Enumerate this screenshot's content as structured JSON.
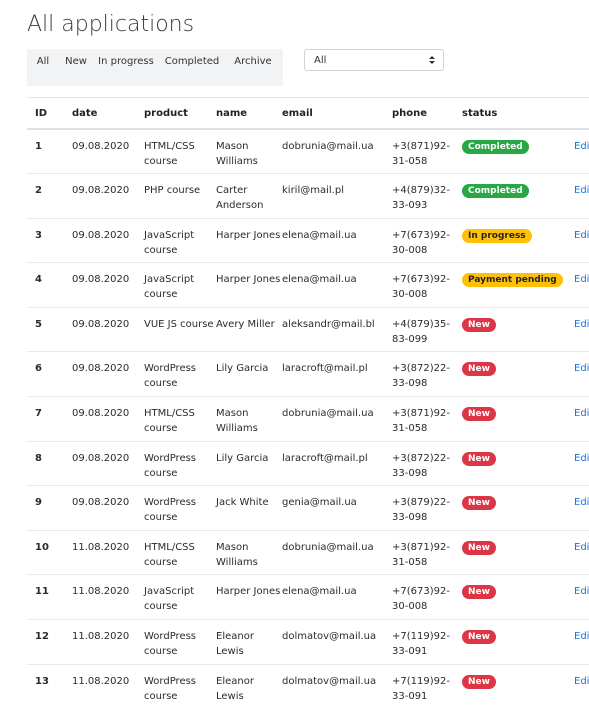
{
  "page_title": "All applications",
  "filters": {
    "tabs": [
      {
        "label": "All"
      },
      {
        "label": "New"
      },
      {
        "label": "In progress"
      },
      {
        "label": "Completed"
      },
      {
        "label": "Archive"
      }
    ],
    "select_value": "All"
  },
  "table": {
    "headers": {
      "id": "ID",
      "date": "date",
      "product": "product",
      "name": "name",
      "email": "email",
      "phone": "phone",
      "status": "status"
    },
    "edit_label": "Edit",
    "rows": [
      {
        "id": "1",
        "date": "09.08.2020",
        "product": "HTML/CSS course",
        "name": "Mason Williams",
        "email": "dobrunia@mail.ua",
        "phone": "+3(871)92-31-058",
        "status": "Completed",
        "status_type": "completed"
      },
      {
        "id": "2",
        "date": "09.08.2020",
        "product": "PHP course",
        "name": "Carter Anderson",
        "email": "kiril@mail.pl",
        "phone": "+4(879)32-33-093",
        "status": "Completed",
        "status_type": "completed"
      },
      {
        "id": "3",
        "date": "09.08.2020",
        "product": "JavaScript course",
        "name": "Harper Jones",
        "email": "elena@mail.ua",
        "phone": "+7(673)92-30-008",
        "status": "In progress",
        "status_type": "progress"
      },
      {
        "id": "4",
        "date": "09.08.2020",
        "product": "JavaScript course",
        "name": "Harper Jones",
        "email": "elena@mail.ua",
        "phone": "+7(673)92-30-008",
        "status": "Payment pending",
        "status_type": "pending"
      },
      {
        "id": "5",
        "date": "09.08.2020",
        "product": "VUE JS course",
        "name": "Avery Miller",
        "email": "aleksandr@mail.bl",
        "phone": "+4(879)35-83-099",
        "status": "New",
        "status_type": "new"
      },
      {
        "id": "6",
        "date": "09.08.2020",
        "product": "WordPress course",
        "name": "Lily Garcia",
        "email": "laracroft@mail.pl",
        "phone": "+3(872)22-33-098",
        "status": "New",
        "status_type": "new"
      },
      {
        "id": "7",
        "date": "09.08.2020",
        "product": "HTML/CSS course",
        "name": "Mason Williams",
        "email": "dobrunia@mail.ua",
        "phone": "+3(871)92-31-058",
        "status": "New",
        "status_type": "new"
      },
      {
        "id": "8",
        "date": "09.08.2020",
        "product": "WordPress course",
        "name": "Lily Garcia",
        "email": "laracroft@mail.pl",
        "phone": "+3(872)22-33-098",
        "status": "New",
        "status_type": "new"
      },
      {
        "id": "9",
        "date": "09.08.2020",
        "product": "WordPress course",
        "name": "Jack White",
        "email": "genia@mail.ua",
        "phone": "+3(879)22-33-098",
        "status": "New",
        "status_type": "new"
      },
      {
        "id": "10",
        "date": "11.08.2020",
        "product": "HTML/CSS course",
        "name": "Mason Williams",
        "email": "dobrunia@mail.ua",
        "phone": "+3(871)92-31-058",
        "status": "New",
        "status_type": "new"
      },
      {
        "id": "11",
        "date": "11.08.2020",
        "product": "JavaScript course",
        "name": "Harper Jones",
        "email": "elena@mail.ua",
        "phone": "+7(673)92-30-008",
        "status": "New",
        "status_type": "new"
      },
      {
        "id": "12",
        "date": "11.08.2020",
        "product": "WordPress course",
        "name": "Eleanor Lewis",
        "email": "dolmatov@mail.ua",
        "phone": "+7(119)92-33-091",
        "status": "New",
        "status_type": "new"
      },
      {
        "id": "13",
        "date": "11.08.2020",
        "product": "WordPress course",
        "name": "Eleanor Lewis",
        "email": "dolmatov@mail.ua",
        "phone": "+7(119)92-33-091",
        "status": "New",
        "status_type": "new"
      }
    ]
  }
}
